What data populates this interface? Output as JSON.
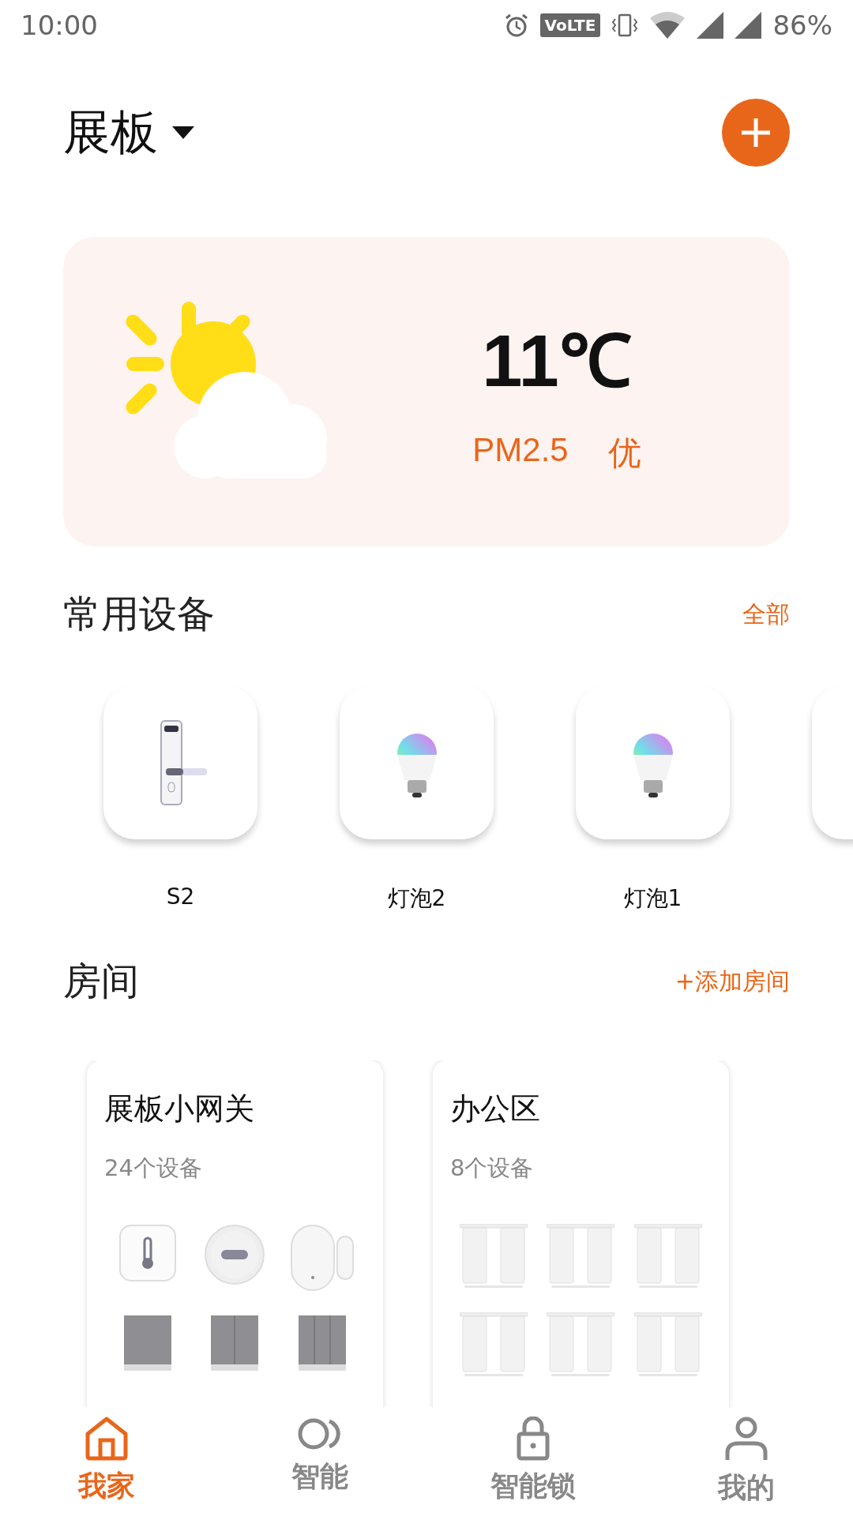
{
  "status_bar": {
    "time": "10:00",
    "badge": "VoLTE",
    "battery": "86%"
  },
  "header": {
    "title": "展板"
  },
  "weather": {
    "temperature": "11℃",
    "air_label": "PM2.5",
    "air_quality": "优"
  },
  "devices_section": {
    "title": "常用设备",
    "action": "全部"
  },
  "devices": [
    {
      "kind": "lock",
      "name": "S2"
    },
    {
      "kind": "bulb",
      "name": "灯泡2"
    },
    {
      "kind": "bulb",
      "name": "灯泡1"
    },
    {
      "kind": "blank"
    }
  ],
  "rooms_section": {
    "title": "房间",
    "action": "+添加房间"
  },
  "rooms": [
    {
      "name": "展板小网关",
      "count": "24个设备",
      "icons": [
        {
          "kind": "thermometer"
        },
        {
          "kind": "sos"
        },
        {
          "kind": "door-sensor"
        },
        {
          "kind": "switch-1"
        },
        {
          "kind": "switch-2"
        },
        {
          "kind": "switch-3"
        }
      ]
    },
    {
      "name": "办公区",
      "count": "8个设备",
      "icons": [
        {
          "kind": "curtain"
        },
        {
          "kind": "curtain"
        },
        {
          "kind": "curtain"
        },
        {
          "kind": "curtain"
        },
        {
          "kind": "curtain"
        },
        {
          "kind": "curtain"
        }
      ]
    }
  ],
  "nav": [
    {
      "kind": "home",
      "label": "我家",
      "selected": true
    },
    {
      "kind": "smart",
      "label": "智能",
      "selected": false
    },
    {
      "kind": "lock",
      "label": "智能锁",
      "selected": false
    },
    {
      "kind": "user",
      "label": "我的",
      "selected": false
    }
  ]
}
